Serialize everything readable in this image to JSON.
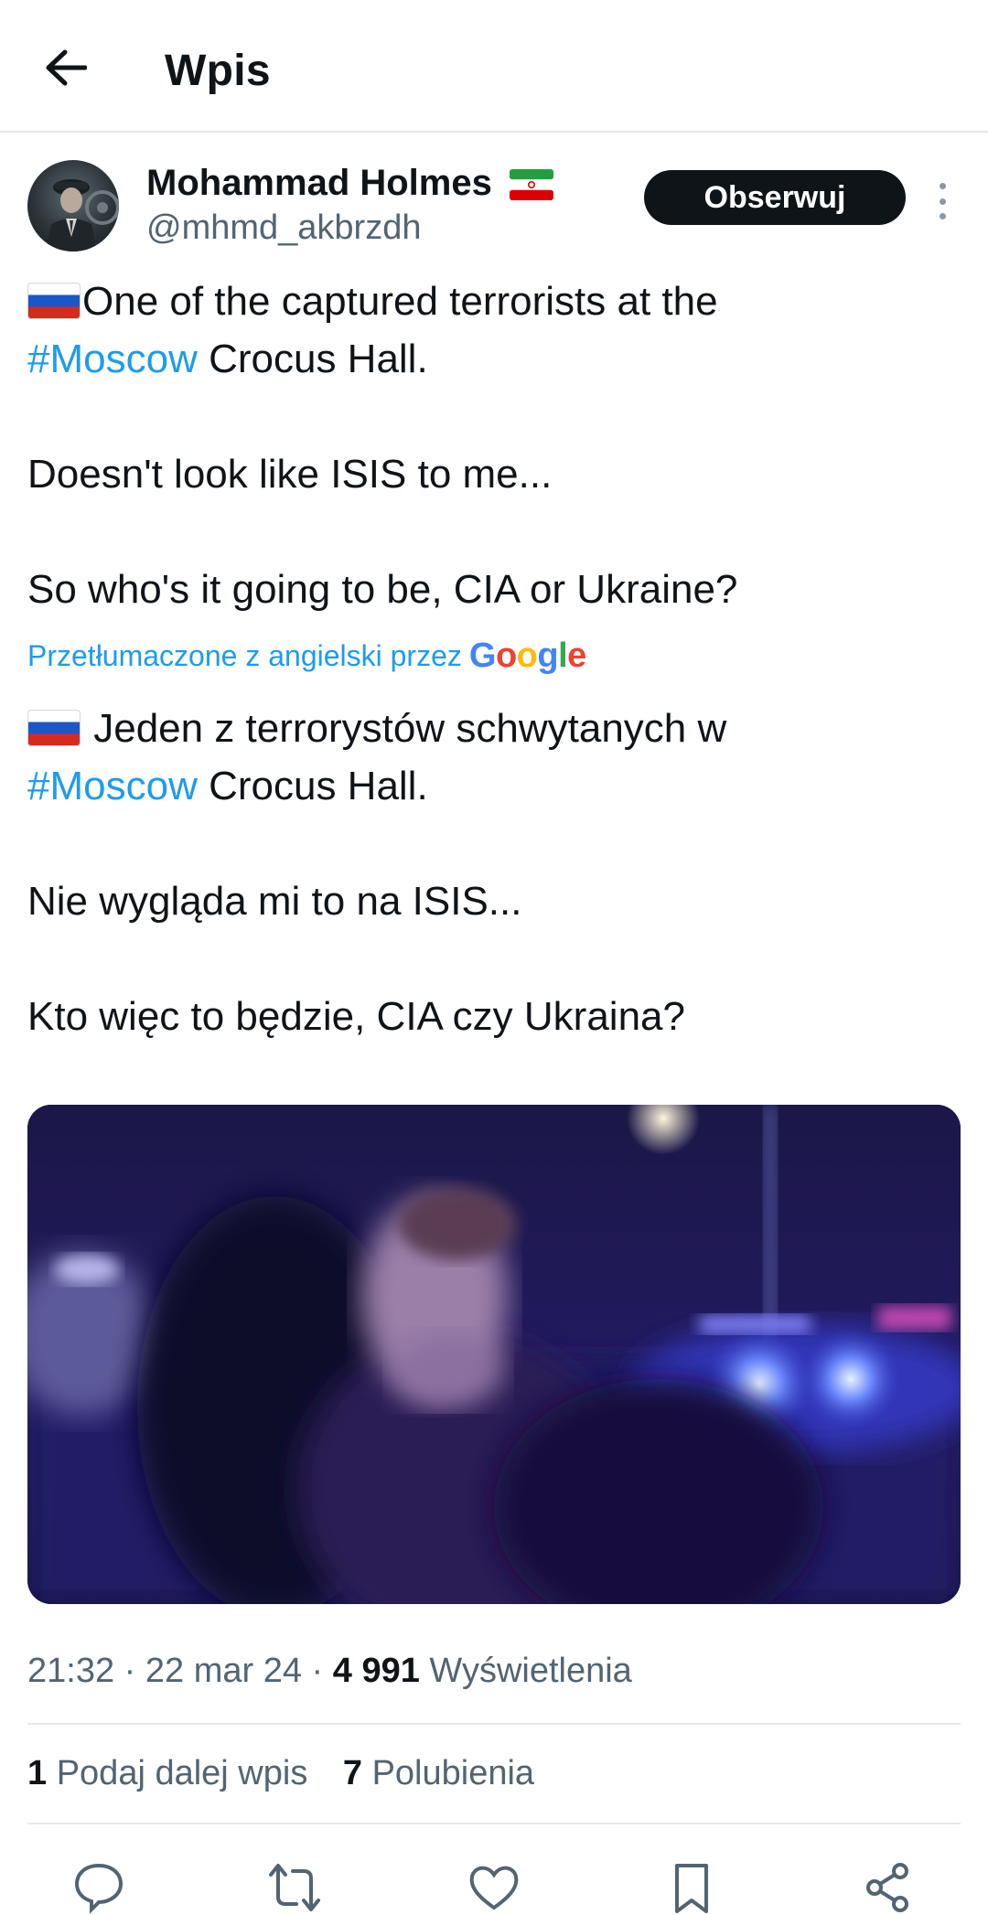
{
  "header": {
    "title": "Wpis",
    "back_icon": "arrow-left-icon"
  },
  "author": {
    "name": "Mohammad Holmes",
    "handle": "@mhmd_akbrzdh",
    "flag": "iran-flag",
    "follow_label": "Obserwuj"
  },
  "tweet": {
    "line1": "One of the captured terrorists at the",
    "line2_tag": "#Moscow",
    "line2_rest": " Crocus Hall.",
    "line3": "Doesn't look like ISIS to me...",
    "line4": "So who's it going to be, CIA or Ukraine?",
    "translated_label": "Przetłumaczone z angielski przez",
    "translator": "Google",
    "tr_line1": " Jeden z terrorystów schwytanych w",
    "tr_line2_tag": "#Moscow",
    "tr_line2_rest": " Crocus Hall.",
    "tr_line3": "Nie wygląda mi to na ISIS...",
    "tr_line4": "Kto więc to będzie, CIA czy Ukraina?"
  },
  "meta": {
    "time": "21:32",
    "date": "22 mar 24",
    "views_count": "4 991",
    "views_label": "Wyświetlenia"
  },
  "stats": {
    "reposts_count": "1",
    "reposts_label": "Podaj dalej wpis",
    "likes_count": "7",
    "likes_label": "Polubienia"
  },
  "colors": {
    "accent": "#1d9bf0",
    "text": "#0f1419",
    "secondary": "#536471",
    "divider": "#e6e9ec"
  }
}
